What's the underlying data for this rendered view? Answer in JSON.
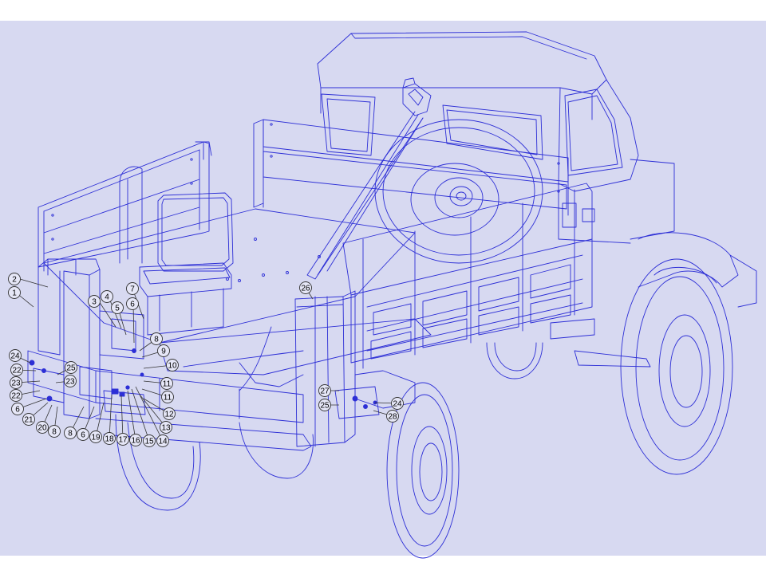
{
  "colors": {
    "page_background": "#ffffff",
    "diagram_background": "#d7d9f1",
    "line_art": "#2d2fd6",
    "callout_fill": "#e6e7f7",
    "callout_stroke": "#333333",
    "callout_text": "#000000"
  },
  "callouts": [
    {
      "id": "c2",
      "label": "2"
    },
    {
      "id": "c1",
      "label": "1"
    },
    {
      "id": "c3",
      "label": "3"
    },
    {
      "id": "c4",
      "label": "4"
    },
    {
      "id": "c5",
      "label": "5"
    },
    {
      "id": "c6a",
      "label": "6"
    },
    {
      "id": "c7",
      "label": "7"
    },
    {
      "id": "c26",
      "label": "26"
    },
    {
      "id": "c8a",
      "label": "8"
    },
    {
      "id": "c9",
      "label": "9"
    },
    {
      "id": "c10",
      "label": "10"
    },
    {
      "id": "c24a",
      "label": "24"
    },
    {
      "id": "c22a",
      "label": "22"
    },
    {
      "id": "c25a",
      "label": "25"
    },
    {
      "id": "c23a",
      "label": "23"
    },
    {
      "id": "c23b",
      "label": "23"
    },
    {
      "id": "c22b",
      "label": "22"
    },
    {
      "id": "c11a",
      "label": "11"
    },
    {
      "id": "c11b",
      "label": "11"
    },
    {
      "id": "c27",
      "label": "27"
    },
    {
      "id": "c25b",
      "label": "25"
    },
    {
      "id": "c24b",
      "label": "24"
    },
    {
      "id": "c28",
      "label": "28"
    },
    {
      "id": "c12",
      "label": "12"
    },
    {
      "id": "c13",
      "label": "13"
    },
    {
      "id": "c6b",
      "label": "6"
    },
    {
      "id": "c21",
      "label": "21"
    },
    {
      "id": "c20",
      "label": "20"
    },
    {
      "id": "c8b",
      "label": "8"
    },
    {
      "id": "c8c",
      "label": "8"
    },
    {
      "id": "c6c",
      "label": "6"
    },
    {
      "id": "c19",
      "label": "19"
    },
    {
      "id": "c18",
      "label": "18"
    },
    {
      "id": "c17",
      "label": "17"
    },
    {
      "id": "c16",
      "label": "16"
    },
    {
      "id": "c15",
      "label": "15"
    },
    {
      "id": "c14",
      "label": "14"
    }
  ]
}
